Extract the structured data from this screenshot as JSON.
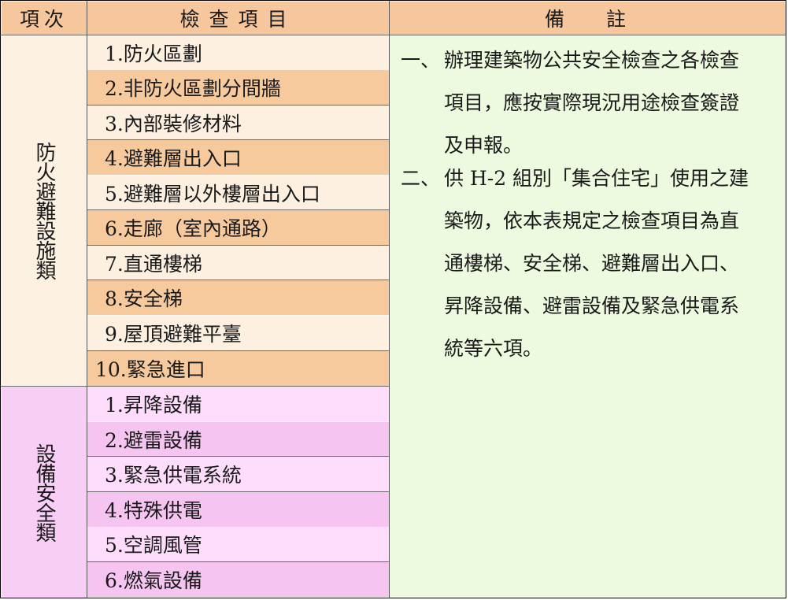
{
  "header": {
    "category": "項次",
    "item": "檢查項目",
    "note_left": "備",
    "note_right": "註"
  },
  "fire_category": "防火避難設施類",
  "fire_items": [
    "1.防火區劃",
    "2.非防火區劃分間牆",
    "3.內部裝修材料",
    "4.避難層出入口",
    "5.避難層以外樓層出入口",
    "6.走廊（室內通路）",
    "7.直通樓梯",
    "8.安全梯",
    "9.屋頂避難平臺",
    "10.緊急進口"
  ],
  "equipment_category": "設備安全類",
  "equipment_items": [
    "1.昇降設備",
    "2.避雷設備",
    "3.緊急供電系統",
    "4.特殊供電",
    "5.空調風管",
    "6.燃氣設備"
  ],
  "notes": [
    {
      "number": "一、",
      "lines": [
        "辦理建築物公共安全檢查之各檢查",
        "項目，應按實際現況用途檢查簽證",
        "及申報。"
      ]
    },
    {
      "number": "二、",
      "lines": [
        "供 H-2 組別「集合住宅」使用之建",
        "築物，依本表規定之檢查項目為直",
        "通樓梯、安全梯、避難層出入口、",
        "昇降設備、避雷設備及緊急供電系",
        "統等六項。"
      ]
    }
  ],
  "colors": {
    "header_bg": "#f6c79c",
    "fire_stripe": "#f7ca9e",
    "fire_light": "#fdf0e1",
    "equipment_stripe": "#f5c4f1",
    "equipment_light": "#fdddfb",
    "notes_bg": "#eefadf"
  }
}
